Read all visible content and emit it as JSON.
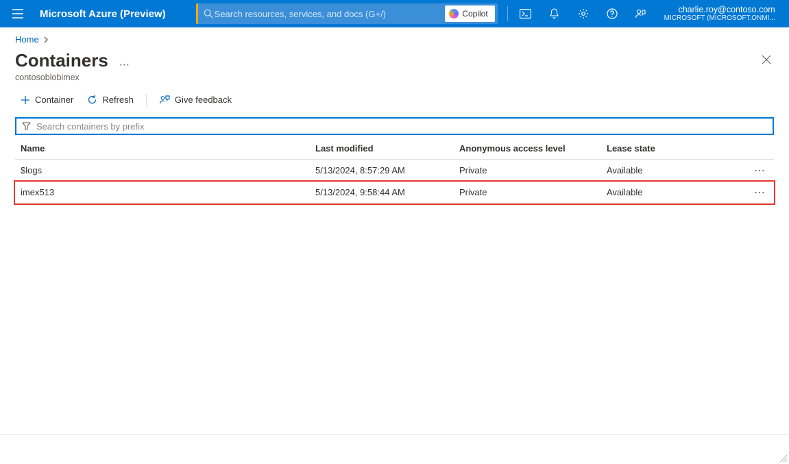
{
  "header": {
    "brand": "Microsoft Azure (Preview)",
    "search_placeholder": "Search resources, services, and docs (G+/)",
    "copilot_label": "Copilot",
    "user_email": "charlie.roy@contoso.com",
    "user_tenant": "MICROSOFT (MICROSOFT.ONMI..."
  },
  "breadcrumb": {
    "items": [
      "Home"
    ]
  },
  "page": {
    "title": "Containers",
    "subtitle": "contosoblobimex"
  },
  "toolbar": {
    "container_label": "Container",
    "refresh_label": "Refresh",
    "feedback_label": "Give feedback"
  },
  "filter": {
    "placeholder": "Search containers by prefix"
  },
  "table": {
    "columns": [
      "Name",
      "Last modified",
      "Anonymous access level",
      "Lease state"
    ],
    "rows": [
      {
        "name": "$logs",
        "modified": "5/13/2024, 8:57:29 AM",
        "access": "Private",
        "lease": "Available",
        "highlight": false
      },
      {
        "name": "imex513",
        "modified": "5/13/2024, 9:58:44 AM",
        "access": "Private",
        "lease": "Available",
        "highlight": true
      }
    ]
  }
}
